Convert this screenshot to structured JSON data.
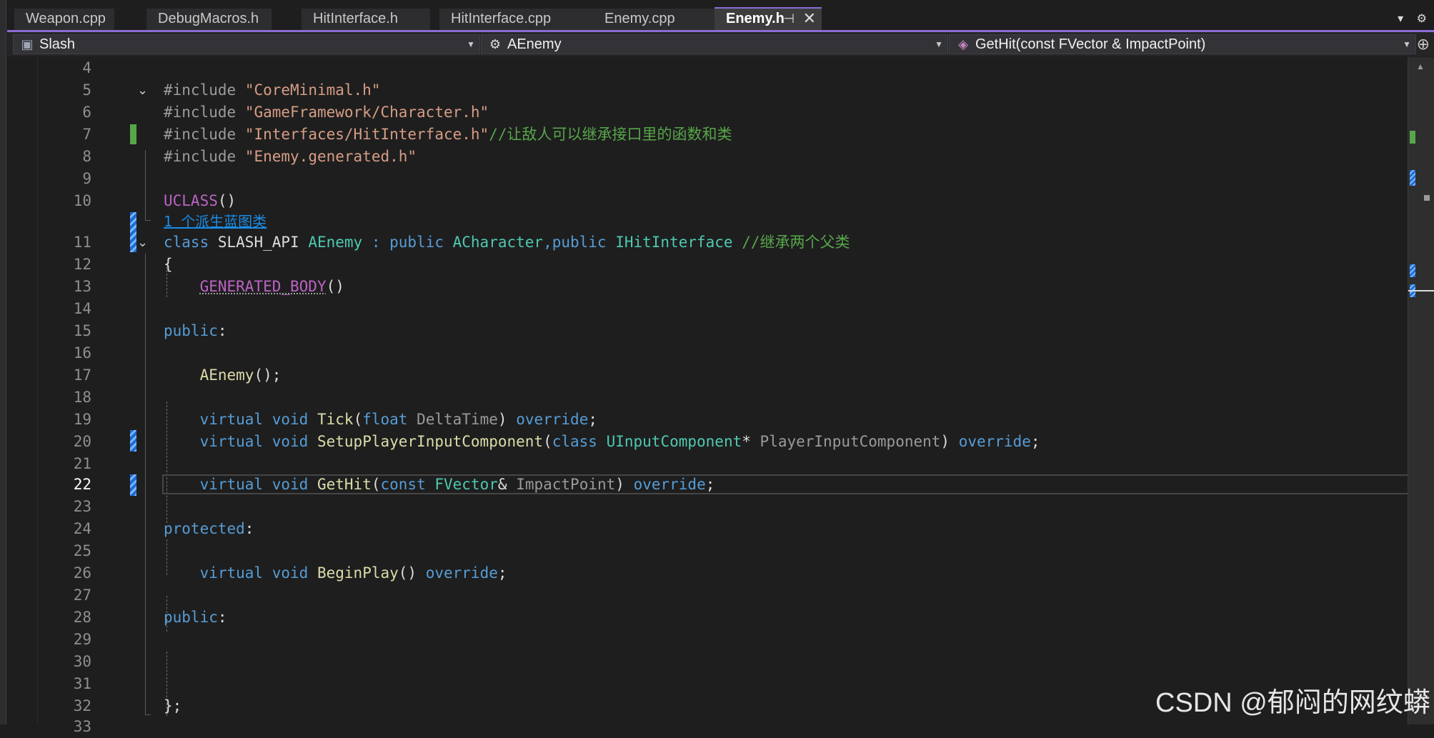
{
  "tabs": [
    {
      "label": "Weapon.cpp"
    },
    {
      "label": "DebugMacros.h"
    },
    {
      "label": "HitInterface.h"
    },
    {
      "label": "HitInterface.cpp"
    },
    {
      "label": "Enemy.cpp"
    },
    {
      "label": "Enemy.h",
      "active": true,
      "pin": "⊣",
      "close": "✕"
    }
  ],
  "tab_menu": {
    "dropdown": "▾",
    "settings": "⚙"
  },
  "nav": {
    "project": "Slash",
    "class_scope": "AEnemy",
    "member": "GetHit(const FVector & ImpactPoint)"
  },
  "codelens": "1 个派生蓝图类",
  "lines": {
    "l4": "4",
    "l5": "5",
    "l6": "6",
    "l7": "7",
    "l8": "8",
    "l9": "9",
    "l10": "10",
    "l11": "11",
    "l12": "12",
    "l13": "13",
    "l14": "14",
    "l15": "15",
    "l16": "16",
    "l17": "17",
    "l18": "18",
    "l19": "19",
    "l20": "20",
    "l21": "21",
    "l22": "22",
    "l23": "23",
    "l24": "24",
    "l25": "25",
    "l26": "26",
    "l27": "27",
    "l28": "28",
    "l29": "29",
    "l30": "30",
    "l31": "31",
    "l32": "32",
    "l33": "33"
  },
  "code": {
    "include": "#include",
    "inc1": "\"CoreMinimal.h\"",
    "inc2": "\"GameFramework/Character.h\"",
    "inc3": "\"Interfaces/HitInterface.h\"",
    "inc3_comment": "//让敌人可以继承接口里的函数和类",
    "inc4": "\"Enemy.generated.h\"",
    "uclass": "UCLASS",
    "class_kw": "class",
    "api": "SLASH_API",
    "aenemy": "AEnemy",
    "colon_public": " : public ",
    "acharacter": "ACharacter",
    "comma_public": ",public ",
    "ihit": "IHitInterface",
    "class_comment": " //继承两个父类",
    "brace_open": "{",
    "generated_body": "GENERATED_BODY",
    "public_label": "public",
    "protected_label": "protected",
    "ctor": "AEnemy",
    "virtual": "virtual",
    "void": "void",
    "tick": "Tick",
    "float": "float",
    "delta": "DeltaTime",
    "override": "override",
    "setup": "SetupPlayerInputComponent",
    "uinput": "UInputComponent",
    "pic": "PlayerInputComponent",
    "gethit": "GetHit",
    "const": "const",
    "fvector": "FVector",
    "impact": "ImpactPoint",
    "beginplay": "BeginPlay",
    "brace_close": "};"
  },
  "watermark": "CSDN @郁闷的网纹蟒"
}
